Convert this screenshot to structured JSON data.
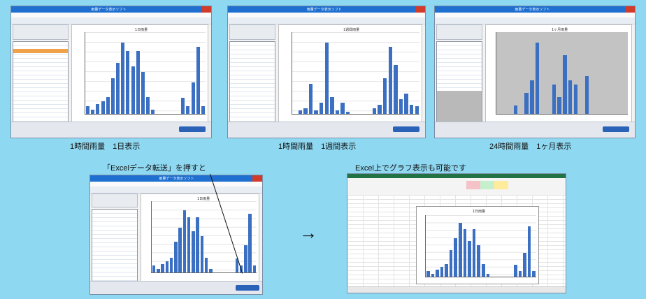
{
  "captions": {
    "shot1": "1時間雨量　1日表示",
    "shot2": "1時間雨量　1週間表示",
    "shot3": "24時間雨量　1ヶ月表示",
    "excel_transfer": "「Excelデータ転送」を押すと",
    "excel_graph": "Excel上でグラフ表示も可能です",
    "arrow": "→"
  },
  "windows": {
    "title": "雨量データ表示ソフト",
    "chart_title_day": "1日雨量",
    "chart_title_week": "1週間雨量",
    "chart_title_month": "1ヶ月雨量",
    "excel_transfer_button": "Excelデータ転送"
  },
  "excel_chart": {
    "title": "1日雨量"
  },
  "colors": {
    "background": "#8fd8f1",
    "bar": "#3b6fc2",
    "titlebar": "#1e6fd0",
    "excel_green": "#217346"
  },
  "chart_data": [
    {
      "type": "bar",
      "title": "1日雨量",
      "values": [
        1,
        0.5,
        1.2,
        1.6,
        2.1,
        4.5,
        6.5,
        9,
        8,
        6,
        8,
        5.3,
        2.1,
        0.5,
        0,
        0,
        0,
        0,
        0,
        2,
        1,
        4,
        8.5,
        1
      ]
    },
    {
      "type": "bar",
      "title": "1週間雨量",
      "values": [
        0,
        2,
        3,
        16,
        2,
        6,
        38,
        9,
        2,
        6,
        1,
        0,
        0,
        0,
        0,
        3,
        5,
        19,
        36,
        26,
        8,
        11,
        5,
        4
      ]
    },
    {
      "type": "bar",
      "title": "1ヶ月雨量",
      "values": [
        0,
        0,
        0,
        2,
        0,
        5,
        8,
        17,
        0,
        0,
        7,
        4,
        14,
        8,
        7,
        0,
        9,
        0,
        0,
        0,
        0,
        0,
        0,
        0
      ]
    },
    {
      "type": "bar",
      "title": "1日雨量",
      "values": [
        1,
        0.5,
        1.2,
        1.6,
        2.1,
        4.5,
        6.5,
        9,
        8,
        6,
        8,
        5.3,
        2.1,
        0.5,
        0,
        0,
        0,
        0,
        0,
        2,
        1,
        4,
        8.5,
        1
      ]
    }
  ]
}
